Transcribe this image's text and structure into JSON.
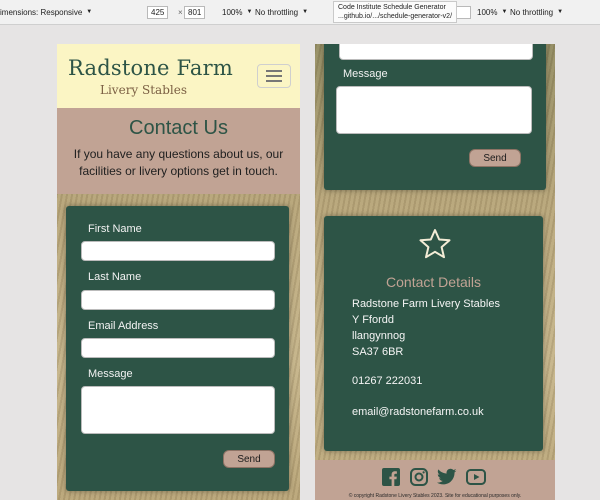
{
  "devtools": {
    "left": {
      "dimensions_label": "imensions: Responsive",
      "width": "425",
      "height": "801",
      "zoom": "100%",
      "throttle": "No throttling"
    },
    "right": {
      "width": "",
      "zoom": "100%",
      "throttle": "No throttling"
    },
    "tooltip": {
      "line1": "Code Institute Schedule Generator",
      "line2": "...github.io/.../schedule-generator-v2/"
    }
  },
  "header": {
    "brand_name": "Radstone Farm",
    "brand_sub": "Livery Stables"
  },
  "hero": {
    "title": "Contact Us",
    "text": "If you have any questions about us, our facilities or livery options get in touch."
  },
  "form": {
    "first_name_label": "First Name",
    "last_name_label": "Last Name",
    "email_label": "Email Address",
    "message_label": "Message",
    "send_label": "Send"
  },
  "contact_details": {
    "title": "Contact Details",
    "address": [
      "Radstone Farm Livery Stables",
      "Y Ffordd",
      "llangynnog",
      "SA37 6BR"
    ],
    "phone": "01267 222031",
    "email": "email@radstonefarm.co.uk"
  },
  "footer": {
    "social": [
      "facebook-icon",
      "instagram-icon",
      "twitter-icon",
      "youtube-icon"
    ],
    "copyright": "© copyright Radstone Livery Stables 2023. Site for educational purposes only."
  },
  "colors": {
    "green": "#2d5446",
    "tan": "#c1a394",
    "cream": "#fbf5c4"
  }
}
